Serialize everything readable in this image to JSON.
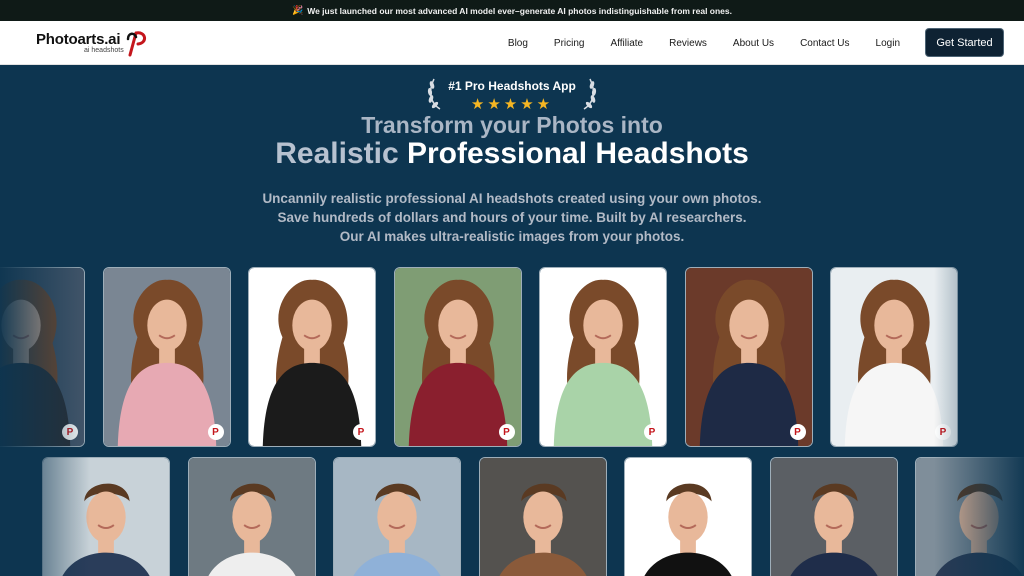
{
  "announcement": {
    "emoji": "🎉",
    "text": "We just launched our most advanced AI model ever–generate AI photos indistinguishable from real ones."
  },
  "brand": {
    "name": "Photoarts.ai",
    "tagline": "ai headshots",
    "accent": "#c4161c"
  },
  "nav": {
    "items": [
      "Blog",
      "Pricing",
      "Affiliate",
      "Reviews",
      "About Us",
      "Contact Us",
      "Login"
    ],
    "cta": "Get Started"
  },
  "hero": {
    "badge": "#1 Pro Headshots App",
    "rating_stars": 5,
    "headline_line1": "Transform your Photos into",
    "headline_muted": "Realistic",
    "headline_bold": "Professional Headshots",
    "sub1": "Uncannily realistic professional AI headshots created using your own photos.",
    "sub2": "Save hundreds of dollars and hours of your time. Built by AI researchers.",
    "sub3": "Our AI makes ultra-realistic images from your photos."
  },
  "gallery": {
    "row1": [
      {
        "name": "woman-dim-left",
        "bg": "#44566a",
        "outfit": "#2a2f36"
      },
      {
        "name": "woman-pink-blazer",
        "bg": "#7a8693",
        "outfit": "#e7a9b3"
      },
      {
        "name": "woman-striped-polo",
        "bg": "#ffffff",
        "outfit": "#1b1b1b"
      },
      {
        "name": "woman-burgundy-blazer",
        "bg": "#7f9d74",
        "outfit": "#8a1f2e"
      },
      {
        "name": "woman-green-top",
        "bg": "#ffffff",
        "outfit": "#a9d3a8"
      },
      {
        "name": "woman-navy-blazer",
        "bg": "#6b3a2a",
        "outfit": "#1e2a45"
      },
      {
        "name": "woman-chef-jacket",
        "bg": "#e9eef1",
        "outfit": "#f6f6f6"
      }
    ],
    "row2": [
      {
        "name": "man-striped-shirt",
        "bg": "#c8d2d8",
        "outfit": "#2a3d5a"
      },
      {
        "name": "man-white-tee",
        "bg": "#6e7a82",
        "outfit": "#eeeeee"
      },
      {
        "name": "man-blue-shirt",
        "bg": "#a7b7c4",
        "outfit": "#8fb1d8"
      },
      {
        "name": "man-brown-blazer",
        "bg": "#54524f",
        "outfit": "#8a5a3a"
      },
      {
        "name": "man-black-turtleneck",
        "bg": "#ffffff",
        "outfit": "#111111"
      },
      {
        "name": "man-navy-suit",
        "bg": "#5b5f64",
        "outfit": "#1f2d4a"
      },
      {
        "name": "man-dim-right",
        "bg": "#7f8e9a",
        "outfit": "#2a3b55"
      }
    ]
  }
}
